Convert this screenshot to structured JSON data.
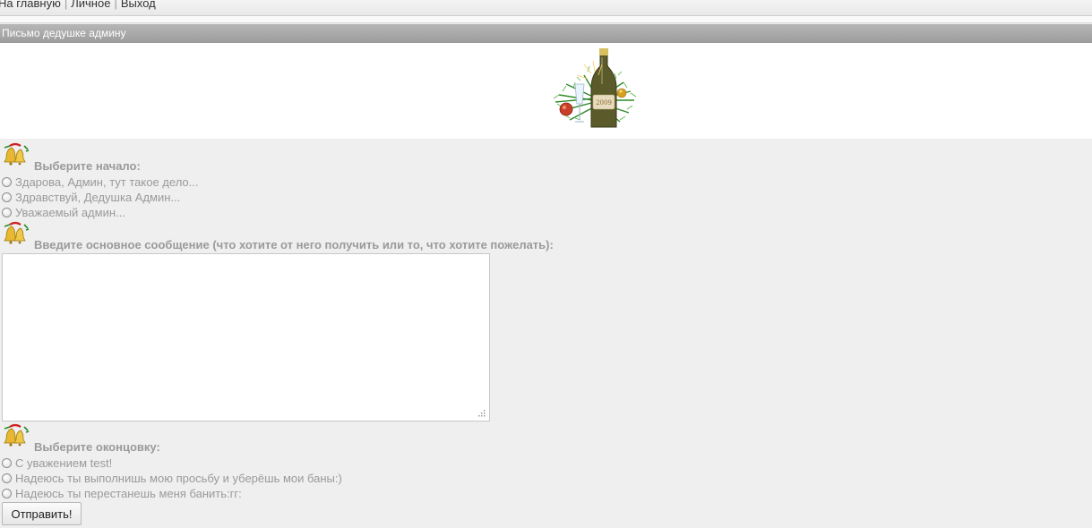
{
  "nav": {
    "home": "На главную",
    "personal": "Личное",
    "logout": "Выход",
    "separator": "|"
  },
  "header": {
    "title": "Письмо дедушке админу"
  },
  "banner": {
    "icon": "champagne-bottle-christmas-image"
  },
  "opening": {
    "label": "Выберите начало:",
    "options": [
      "Здарова, Админ, тут такое дело...",
      "Здравствуй, Дедушка Админ...",
      "Уважаемый админ..."
    ]
  },
  "message": {
    "label": "Введите основное сообщение (что хотите от него получить или то, что хотите пожелать):",
    "value": ""
  },
  "closing": {
    "label": "Выберите оконцовку:",
    "options": [
      "С уважением test!",
      "Надеюсь ты выполнишь мою просьбу и уберёшь мои баны:)",
      "Надеюсь ты перестанешь меня банить:гг:"
    ]
  },
  "submit": {
    "label": "Отправить!"
  },
  "colors": {
    "header_bar": "#a8a8a8",
    "page_background": "#efefef",
    "label_text": "#9a9a9a"
  }
}
